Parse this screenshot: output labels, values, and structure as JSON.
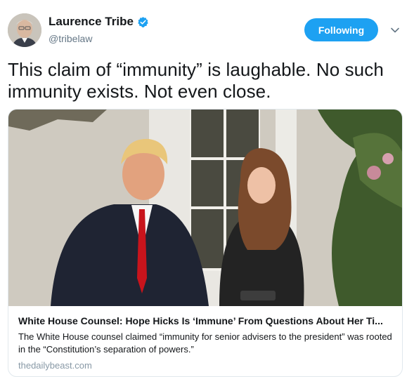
{
  "author": {
    "name": "Laurence Tribe",
    "handle": "@tribelaw",
    "verified_icon": "verified-badge-icon"
  },
  "follow_button": {
    "label": "Following"
  },
  "tweet": {
    "text": "This claim of “immunity” is laughable. No such immunity exists. Not even close."
  },
  "card": {
    "title": "White House Counsel: Hope Hicks Is ‘Immune’ From Questions About Her Ti...",
    "description": "The White House counsel claimed “immunity for senior advisers to the president” was rooted in the “Constitution’s separation of powers.”",
    "domain": "thedailybeast.com"
  },
  "colors": {
    "accent": "#1da1f2",
    "handle": "#657786",
    "border": "#e1e8ed"
  }
}
